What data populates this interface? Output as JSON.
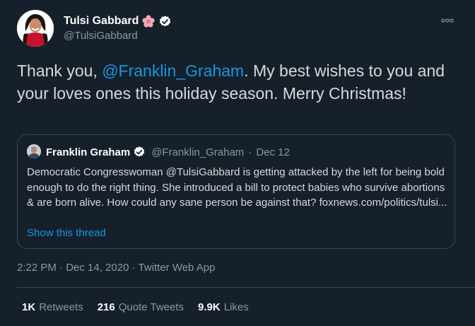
{
  "author": {
    "display_name": "Tulsi Gabbard",
    "handle": "@TulsiGabbard",
    "flower_icon": "hibiscus-emoji",
    "verified_icon": "verified-badge"
  },
  "tweet": {
    "text_before": "Thank you, ",
    "mention": "@Franklin_Graham",
    "text_after": ". My best wishes to you and your loves ones this holiday season. Merry Christmas!"
  },
  "quoted": {
    "display_name": "Franklin Graham",
    "handle": "@Franklin_Graham",
    "separator": "·",
    "date": "Dec 12",
    "body": "Democratic Congresswoman @TulsiGabbard is getting attacked by the left for being bold enough to do the right thing. She introduced a bill to protect babies who survive abortions & are born alive. How could any sane person be against that? foxnews.com/politics/tulsi...",
    "show_thread": "Show this thread"
  },
  "meta": {
    "timestamp": "2:22 PM · Dec 14, 2020 · Twitter Web App"
  },
  "stats": {
    "retweets_count": "1K",
    "retweets_label": "Retweets",
    "quotes_count": "216",
    "quotes_label": "Quote Tweets",
    "likes_count": "9.9K",
    "likes_label": "Likes"
  },
  "colors": {
    "background": "#15202b",
    "link": "#1b95e0",
    "secondary_text": "#8899a6",
    "border": "#38444d"
  }
}
